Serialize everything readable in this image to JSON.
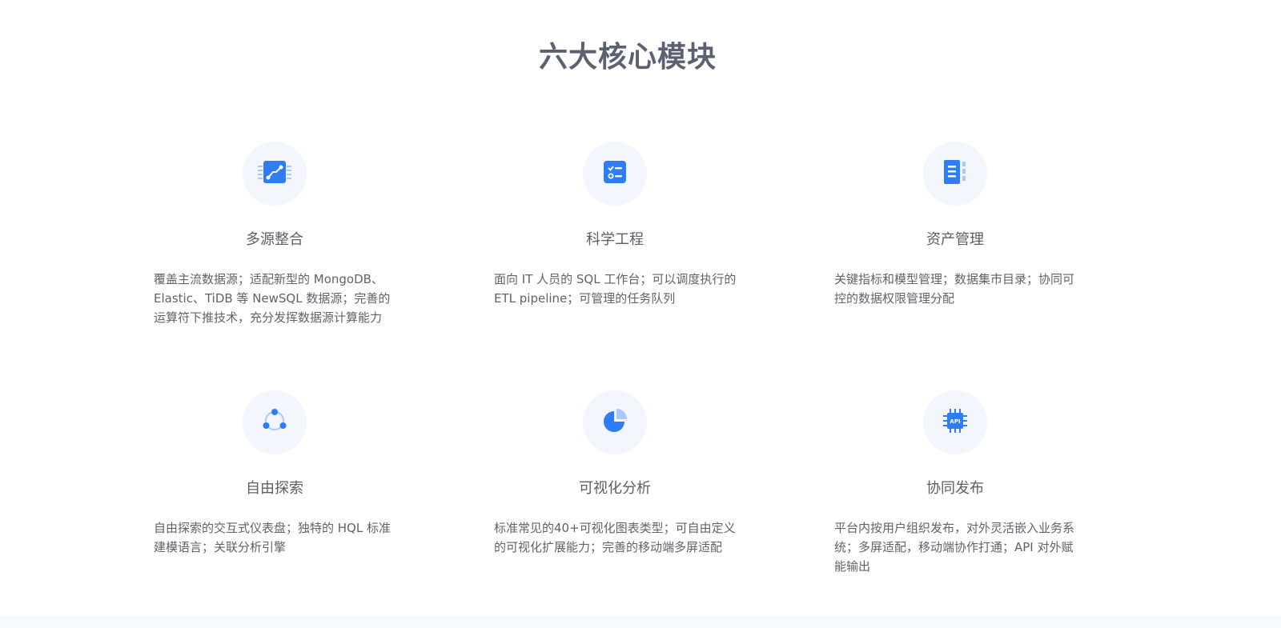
{
  "title": "六大核心模块",
  "modules": [
    {
      "icon": "data-integration-icon",
      "title": "多源整合",
      "description": "覆盖主流数据源；适配新型的 MongoDB、Elastic、TiDB 等 NewSQL 数据源；完善的运算符下推技术，充分发挥数据源计算能力"
    },
    {
      "icon": "task-checklist-icon",
      "title": "科学工程",
      "description": "面向 IT 人员的 SQL 工作台；可以调度执行的 ETL pipeline；可管理的任务队列"
    },
    {
      "icon": "asset-document-icon",
      "title": "资产管理",
      "description": "关键指标和模型管理；数据集市目录；协同可控的数据权限管理分配"
    },
    {
      "icon": "network-nodes-icon",
      "title": "自由探索",
      "description": "自由探索的交互式仪表盘；独特的 HQL 标准建模语言；关联分析引擎"
    },
    {
      "icon": "pie-chart-icon",
      "title": "可视化分析",
      "description": "标准常见的40+可视化图表类型；可自由定义的可视化扩展能力；完善的移动端多屏适配"
    },
    {
      "icon": "api-chip-icon",
      "title": "协同发布",
      "description": "平台内按用户组织发布，对外灵活嵌入业务系统；多屏适配，移动端协作打通；API 对外赋能输出"
    }
  ],
  "colors": {
    "accent": "#2e7cf6",
    "accent_light": "#a9c8fb",
    "icon_bg": "#f3f7fd",
    "text": "#5f6368"
  }
}
